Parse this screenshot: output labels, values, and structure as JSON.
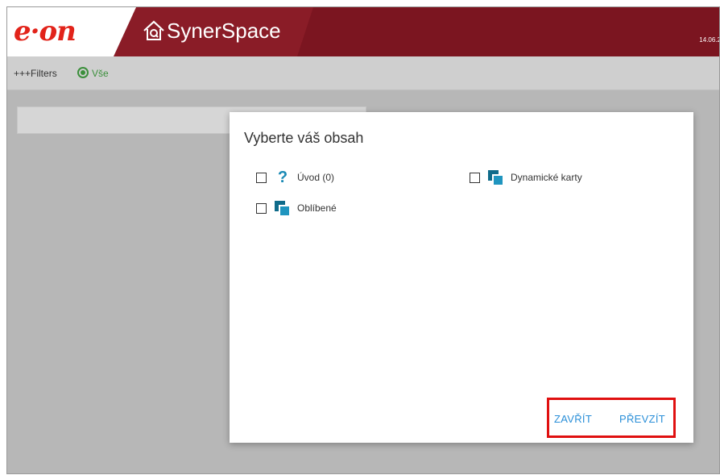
{
  "header": {
    "logo_text": "e·on",
    "app_name": "SynerSpace",
    "home_icon": "home-search-icon",
    "date_text": "14.06.2"
  },
  "toolbar": {
    "filters_text": "+++Filters",
    "radio_label": "Vše"
  },
  "dialog": {
    "title": "Vyberte váš obsah",
    "options": [
      {
        "label": "Úvod (0)",
        "icon": "question-icon"
      },
      {
        "label": "Dynamické karty",
        "icon": "cards-icon"
      },
      {
        "label": "Oblíbené",
        "icon": "cards-icon"
      }
    ],
    "close_label": "ZAVŘÍT",
    "accept_label": "PŘEVZÍT"
  },
  "colors": {
    "brand_red": "#8a1c27",
    "logo_red": "#e2231a",
    "accent_blue": "#2a8fd8",
    "highlight_red": "#e01010"
  }
}
